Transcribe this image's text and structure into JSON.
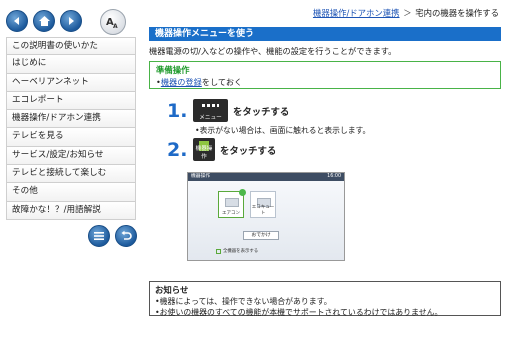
{
  "nav": {
    "items": [
      {
        "label": "この説明書の使いかた"
      },
      {
        "label": "はじめに"
      },
      {
        "label": "ヘーベリアンネット"
      },
      {
        "label": "エコレポート"
      },
      {
        "label": "機器操作/ドアホン連携"
      },
      {
        "label": "テレビを見る"
      },
      {
        "label": "サービス/設定/お知らせ"
      },
      {
        "label": "テレビと接続して楽しむ"
      },
      {
        "label": "その他"
      },
      {
        "label": "故障かな！？/用語解説"
      }
    ],
    "toolbar_icons": [
      "back-arrow-icon",
      "home-icon",
      "forward-arrow-icon",
      "font-size-icon"
    ],
    "bottom_icons": [
      "list-icon",
      "return-icon"
    ]
  },
  "breadcrumb": {
    "link": "機器操作/ドアホン連携",
    "separator": "＞",
    "current": "宅内の機器を操作する"
  },
  "main": {
    "title": "機器操作メニューを使う",
    "lead": "機器電源の切/入などの操作や、機能の設定を行うことができます。",
    "prep": {
      "title": "準備操作",
      "link": "機器の登録",
      "suffix": "をしておく"
    },
    "steps": [
      {
        "number": "1.",
        "icon_caption": "メニュー",
        "label": "をタッチする",
        "note": "表示がない場合は、画面に触れると表示します。"
      },
      {
        "number": "2.",
        "icon_caption": "機器操作",
        "label": "をタッチする"
      }
    ],
    "screenshot": {
      "title": "機器操作",
      "time": "16:00",
      "tiles": [
        {
          "label": "エアコン"
        },
        {
          "label": "エコキュート"
        }
      ],
      "button": "おでかけ",
      "checkbox": "全機器を表示する"
    }
  },
  "info": {
    "title": "お知らせ",
    "items": [
      "機器によっては、操作できない場合があります。",
      "お使いの機器のすべての機能が本機でサポートされているわけではありません。"
    ]
  },
  "colors": {
    "accent": "#1a6fc9",
    "prep_border": "#49b347",
    "link": "#1e54b5"
  }
}
